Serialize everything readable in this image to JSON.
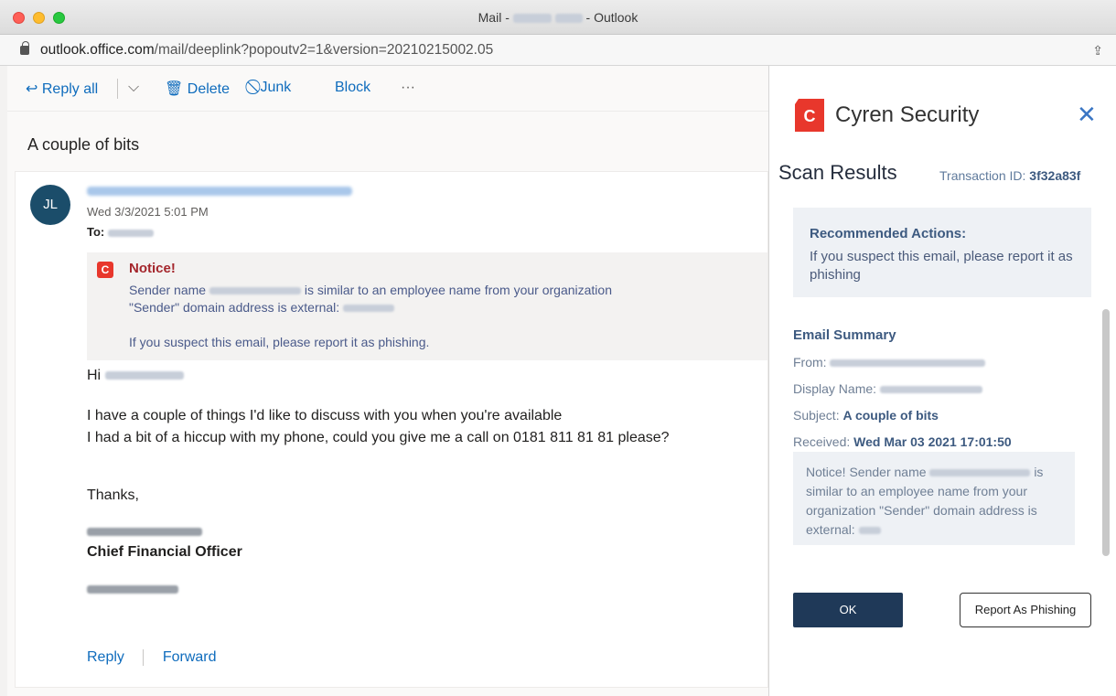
{
  "window": {
    "title_prefix": "Mail -",
    "title_suffix": "- Outlook",
    "url_host": "outlook.office.com",
    "url_path": "/mail/deeplink?popoutv2=1&version=20210215002.05"
  },
  "toolbar": {
    "reply_all": "Reply all",
    "delete": "Delete",
    "junk": "Junk",
    "block": "Block",
    "more": "···"
  },
  "message": {
    "subject": "A couple of bits",
    "avatar_initials": "JL",
    "date": "Wed 3/3/2021 5:01 PM",
    "to_label": "To:",
    "notice": {
      "title": "Notice!",
      "line1_a": "Sender name",
      "line1_b": "is similar to an employee name from your organization",
      "line2": "\"Sender\" domain address is external:",
      "line3": "If you suspect this email, please report it as phishing."
    },
    "greeting": "Hi",
    "body_line1": "I have a couple of things I'd like to discuss with you when you're available",
    "body_line2": "I had a bit of a hiccup with my phone, could you give me a call on 0181 811 81 81 please?",
    "thanks": "Thanks,",
    "signature_title": "Chief Financial Officer",
    "reply": "Reply",
    "forward": "Forward"
  },
  "panel": {
    "brand": "Cyren Security",
    "close": "✕",
    "scan_title": "Scan Results",
    "transaction_label": "Transaction ID:",
    "transaction_id": "3f32a83f",
    "recommended_title": "Recommended Actions:",
    "recommended_text": "If you suspect this email, please report it as phishing",
    "summary_title": "Email Summary",
    "from_label": "From:",
    "display_name_label": "Display Name:",
    "subject_label": "Subject:",
    "subject_value": "A couple of bits",
    "received_label": "Received:",
    "received_value": "Wed Mar 03 2021 17:01:50",
    "note_a": "Notice! Sender name",
    "note_b": "is similar to an employee name from your organization \"Sender\" domain address is external:",
    "ok": "OK",
    "report": "Report As Phishing"
  },
  "colors": {
    "brand_red": "#e8372c",
    "link_blue": "#0f6cbd",
    "ok_navy": "#1f3958"
  }
}
